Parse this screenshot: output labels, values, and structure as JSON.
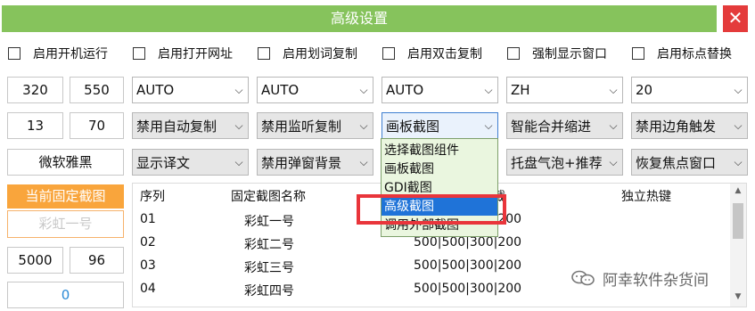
{
  "window": {
    "title": "高级设置",
    "close": "✕"
  },
  "checkboxes": [
    "启用开机运行",
    "启用打开网址",
    "启用划词复制",
    "启用双击复制",
    "强制显示窗口",
    "启用标点替换"
  ],
  "inputs": {
    "w": "320",
    "h": "550",
    "x": "13",
    "y": "70",
    "font": "微软雅黑",
    "n1": "5000",
    "n2": "96",
    "counter": "0"
  },
  "row1_selects": [
    "AUTO",
    "AUTO",
    "AUTO",
    "ZH",
    "20"
  ],
  "row2_selects": [
    "禁用自动复制",
    "禁用监听复制",
    "画板截图",
    "智能合并缩进",
    "禁用边角触发"
  ],
  "row3_selects": [
    "显示译文",
    "禁用弹窗背景",
    "",
    "托盘气泡+推荐",
    "恢复焦点窗口"
  ],
  "buttons": {
    "current_pin": "当前固定截图",
    "rainbow": "彩虹一号"
  },
  "table": {
    "headers": [
      "序列",
      "固定截图名称",
      "截",
      "独立热键"
    ],
    "rows": [
      {
        "idx": "01",
        "name": "彩虹一号",
        "geo": "500|500|300|200"
      },
      {
        "idx": "02",
        "name": "彩虹二号",
        "geo": "500|500|300|200"
      },
      {
        "idx": "03",
        "name": "彩虹三号",
        "geo": "500|500|300|200"
      },
      {
        "idx": "04",
        "name": "彩虹四号",
        "geo": "500|500|300|200"
      }
    ]
  },
  "dropdown": {
    "options": [
      "选择截图组件",
      "画板截图",
      "GDI截图",
      "高级截图",
      "调用外部截图"
    ],
    "selected_index": 3
  },
  "watermark": "阿幸软件杂货间",
  "icons": {
    "arrow": "chevron-down-icon",
    "scroll_up": "▲",
    "scroll_down": "▼"
  },
  "colors": {
    "title_bar": "#86c35c",
    "close": "#e43b3b",
    "orange": "#f9a53c",
    "highlight": "#1f73d8",
    "red_annotation": "#e9353b"
  }
}
